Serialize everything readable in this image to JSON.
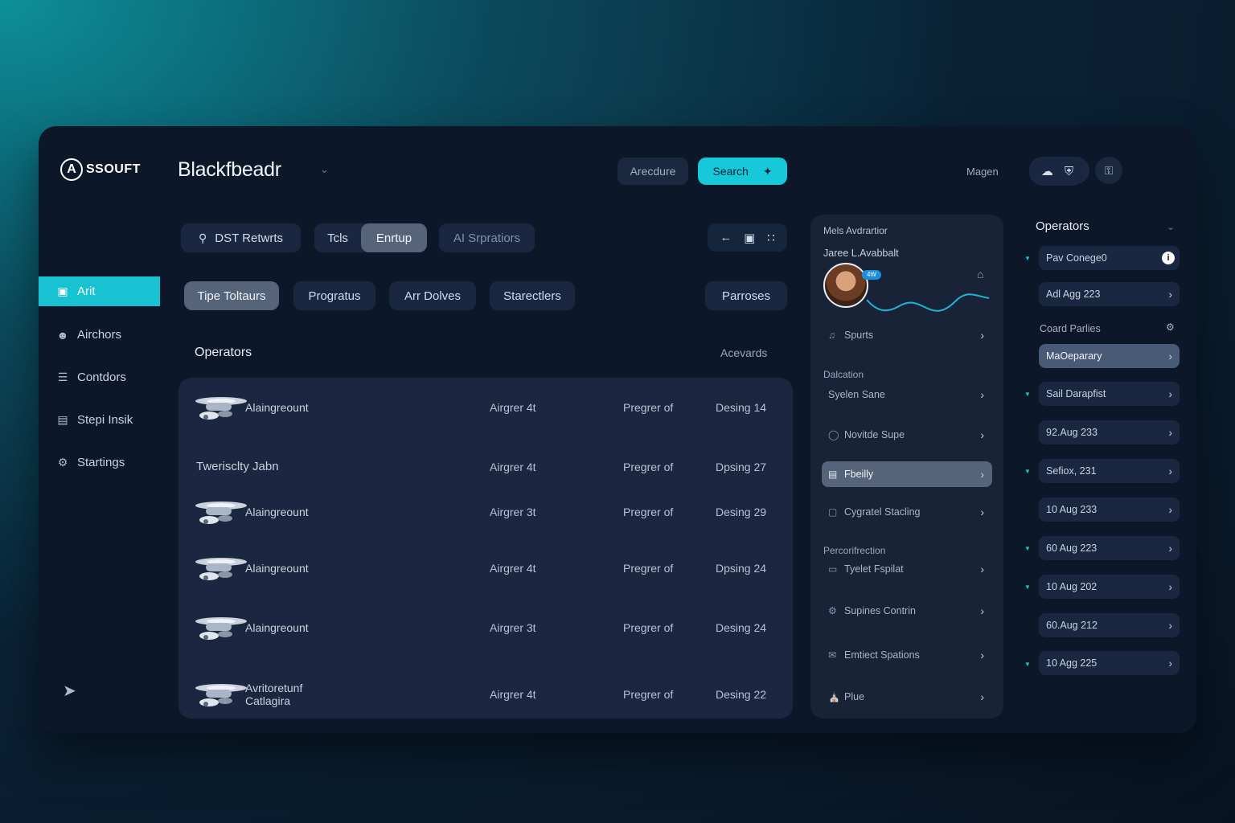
{
  "header": {
    "logo_text": "SSOUFT",
    "app_title": "Blackfbeadr",
    "outline_button": "Arecdure",
    "search_button": "Search",
    "user_name": "Magen"
  },
  "sidebar": {
    "items": [
      {
        "label": "Arit",
        "icon": "dashboard-icon",
        "active": true
      },
      {
        "label": "Airchors",
        "icon": "user-icon"
      },
      {
        "label": "Contdors",
        "icon": "list-icon"
      },
      {
        "label": "Stepi Insik",
        "icon": "task-icon"
      },
      {
        "label": "Startings",
        "icon": "settings-icon"
      }
    ]
  },
  "toolbar": {
    "search_pill": "DST Retwrts",
    "tab1": "Tcls",
    "tab2": "Enrtup",
    "tab3": "AI Srpratiors",
    "filters": [
      "Tipe Toltaurs",
      "Progratus",
      "Arr Dolves",
      "Starectlers"
    ],
    "filter_right": "Parroses"
  },
  "main": {
    "section_title": "Operators",
    "section_link": "Acevards",
    "rows": [
      {
        "name": "Alaingreount",
        "c2": "Airgrer 4t",
        "c3": "Pregrer of",
        "c4": "Desing 14",
        "thumb": true
      },
      {
        "name": "Twerisclty Jabn",
        "c2": "Airgrer 4t",
        "c3": "Pregrer of",
        "c4": "Dpsing 27",
        "thumb": false
      },
      {
        "name": "Alaingreount",
        "c2": "Airgrer 3t",
        "c3": "Pregrer of",
        "c4": "Desing 29",
        "thumb": true
      },
      {
        "name": "Alaingreount",
        "c2": "Airgrer 4t",
        "c3": "Pregrer of",
        "c4": "Dpsing 24",
        "thumb": true
      },
      {
        "name": "Alaingreount",
        "c2": "Airgrer 3t",
        "c3": "Pregrer of",
        "c4": "Desing 24",
        "thumb": true
      },
      {
        "name": "Avritoretunf\nCatlagira",
        "c2": "Airgrer 4t",
        "c3": "Pregrer of",
        "c4": "Desing 22",
        "thumb": true
      }
    ]
  },
  "panel": {
    "heading": "Mels Avdrartior",
    "subheading": "Jaree L.Avabbalt",
    "badge": "4W",
    "rows": [
      {
        "label": "Spurts",
        "icon": "music-icon"
      },
      {
        "label": "Syelen Sane",
        "icon": ""
      },
      {
        "label": "Novitde Supe",
        "icon": "bulb-icon"
      },
      {
        "label": "Fbeilly",
        "icon": "doc-icon",
        "selected": true
      },
      {
        "label": "Cygratel Stacling",
        "icon": "box-icon"
      },
      {
        "label": "Tyelet Fspilat",
        "icon": "card-icon"
      },
      {
        "label": "Supines Contrin",
        "icon": "gear-icon"
      },
      {
        "label": "Emtiect Spations",
        "icon": "chat-icon"
      },
      {
        "label": "Plue",
        "icon": "building-icon"
      }
    ],
    "label_dalcation": "Dalcation",
    "label_perconfrection": "Percorifrection"
  },
  "right": {
    "title": "Operators",
    "top_item": "Pav Conege0",
    "items": [
      "Adl Agg 223",
      "MaOeparary",
      "Sail Darapfist",
      "92.Aug 233",
      "Sefiox, 231",
      "10 Aug 233",
      "60 Aug 223",
      "10 Aug 202",
      "60.Aug 212",
      "10 Agg 225"
    ],
    "label": "Coard Parlies"
  },
  "colors": {
    "accent": "#17c2d3",
    "window": "#0c1729",
    "card": "#1b2740",
    "selected": "#56647a"
  }
}
